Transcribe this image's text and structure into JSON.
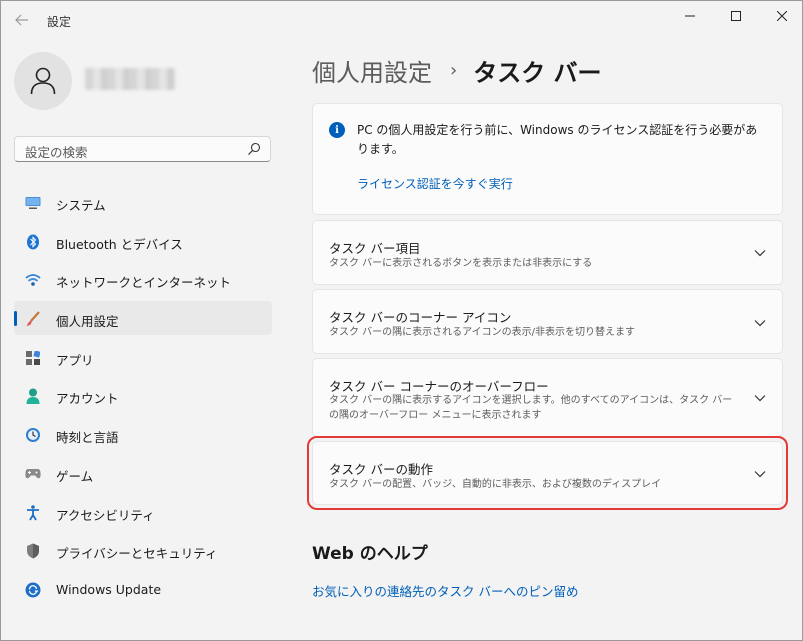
{
  "window": {
    "title": "設定"
  },
  "search": {
    "placeholder": "設定の検索"
  },
  "sidebar": {
    "items": [
      {
        "label": "システム",
        "icon": "monitor-icon"
      },
      {
        "label": "Bluetooth とデバイス",
        "icon": "bluetooth-icon"
      },
      {
        "label": "ネットワークとインターネット",
        "icon": "wifi-icon"
      },
      {
        "label": "個人用設定",
        "icon": "brush-icon",
        "active": true
      },
      {
        "label": "アプリ",
        "icon": "apps-icon"
      },
      {
        "label": "アカウント",
        "icon": "person-icon"
      },
      {
        "label": "時刻と言語",
        "icon": "clock-globe-icon"
      },
      {
        "label": "ゲーム",
        "icon": "gamepad-icon"
      },
      {
        "label": "アクセシビリティ",
        "icon": "accessibility-icon"
      },
      {
        "label": "プライバシーとセキュリティ",
        "icon": "shield-icon"
      },
      {
        "label": "Windows Update",
        "icon": "update-icon"
      }
    ]
  },
  "breadcrumb": {
    "parent": "個人用設定",
    "separator": "›",
    "current": "タスク バー"
  },
  "notice": {
    "text": "PC の個人用設定を行う前に、Windows のライセンス認証を行う必要があります。",
    "link": "ライセンス認証を今すぐ実行"
  },
  "cards": [
    {
      "title": "タスク バー項目",
      "desc": "タスク バーに表示されるボタンを表示または非表示にする"
    },
    {
      "title": "タスク バーのコーナー アイコン",
      "desc": "タスク バーの隅に表示されるアイコンの表示/非表示を切り替えます"
    },
    {
      "title": "タスク バー コーナーのオーバーフロー",
      "desc": "タスク バーの隅に表示するアイコンを選択します。他のすべてのアイコンは、タスク バーの隅のオーバーフロー メニューに表示されます"
    },
    {
      "title": "タスク バーの動作",
      "desc": "タスク バーの配置、バッジ、自動的に非表示、および複数のディスプレイ"
    }
  ],
  "help": {
    "title": "Web のヘルプ",
    "link": "お気に入りの連絡先のタスク バーへのピン留め"
  },
  "colors": {
    "accent": "#005fb8",
    "highlight": "#e53935"
  }
}
